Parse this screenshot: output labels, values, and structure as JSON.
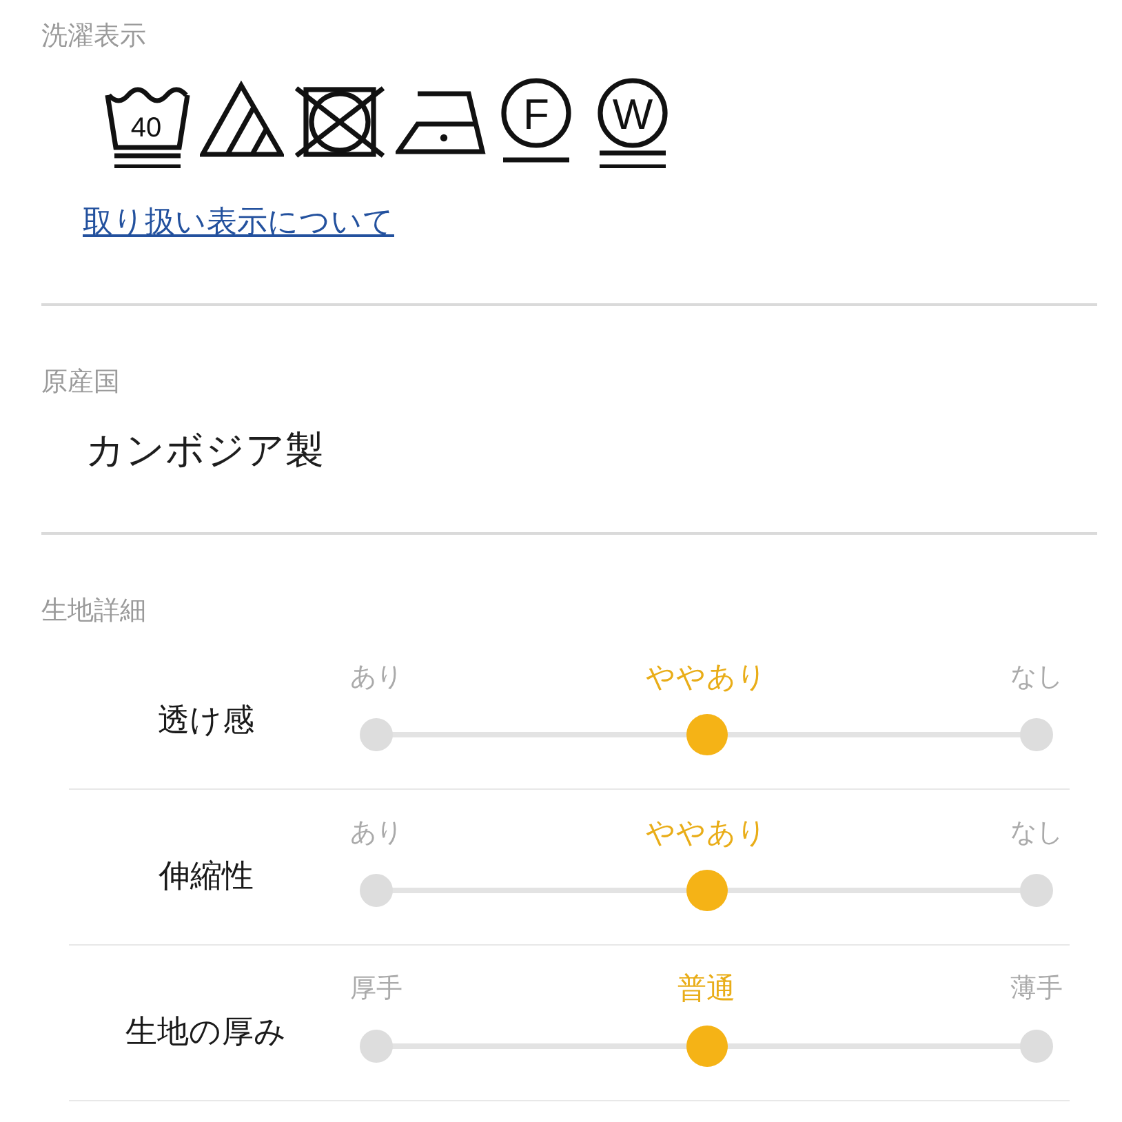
{
  "care_labels": {
    "title": "洗濯表示",
    "symbols": [
      {
        "kind": "wash",
        "text": "40",
        "underlined": true,
        "double_underline": true
      },
      {
        "kind": "oxygen-bleach"
      },
      {
        "kind": "tumble-dry-prohibited"
      },
      {
        "kind": "low-iron"
      },
      {
        "kind": "dry-clean",
        "text": "F",
        "underlined": true,
        "double_underline": false
      },
      {
        "kind": "wet-clean",
        "text": "W",
        "underlined": true,
        "double_underline": true
      }
    ],
    "link": "取り扱い表示について"
  },
  "origin": {
    "title": "原産国",
    "value": "カンボジア製"
  },
  "fabric_details": {
    "title": "生地詳細",
    "rows": [
      {
        "label": "透け感",
        "options": [
          {
            "label": "あり",
            "selected": false
          },
          {
            "label": "ややあり",
            "selected": true
          },
          {
            "label": "なし",
            "selected": false
          }
        ]
      },
      {
        "label": "伸縮性",
        "options": [
          {
            "label": "あり",
            "selected": false
          },
          {
            "label": "ややあり",
            "selected": true
          },
          {
            "label": "なし",
            "selected": false
          }
        ]
      },
      {
        "label": "生地の厚み",
        "options": [
          {
            "label": "厚手",
            "selected": false
          },
          {
            "label": "普通",
            "selected": true
          },
          {
            "label": "薄手",
            "selected": false
          }
        ]
      }
    ]
  }
}
